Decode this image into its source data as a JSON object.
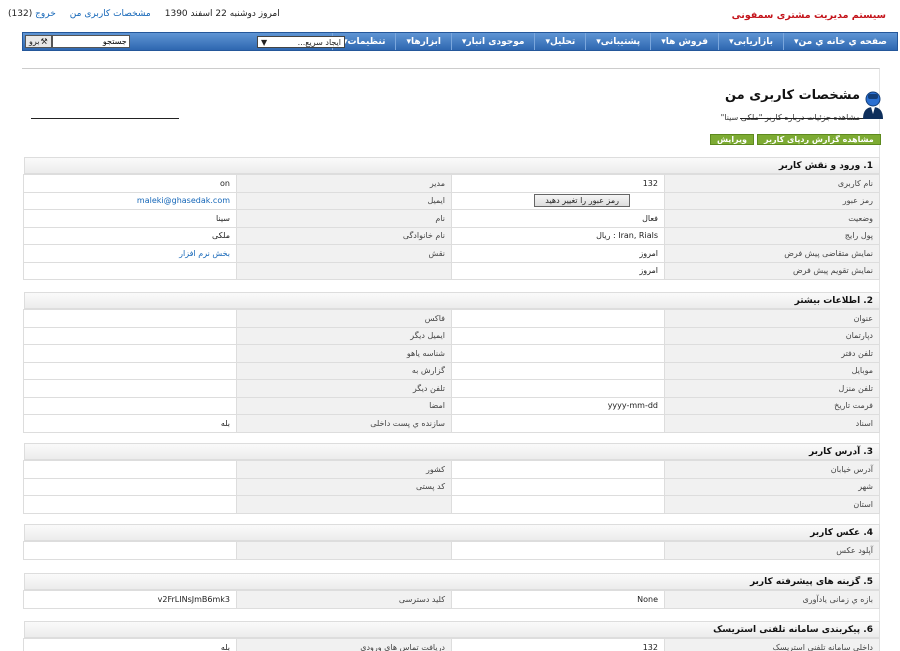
{
  "top": {
    "brand": "سیستم مدیریت مشتری سمفونی",
    "date": "امروز دوشنبه 22 اسفند 1390",
    "profile_link": "مشخصات کاربری من",
    "logout": "خروج",
    "logout_count": "(132)"
  },
  "nav": {
    "menu": [
      "صفحه ي خانه ي من▾",
      "بازاریابی▾",
      "فروش ها▾",
      "پشتیبانی▾",
      "تحلیل▾",
      "موجودی انبار▾",
      "ابزارها▾",
      "تنظیمات▾"
    ],
    "quick_create": "ایجاد سریع...",
    "search_placeholder": "جستجو",
    "go": "برو"
  },
  "page": {
    "title": "مشخصات کاربری من",
    "subtitle": "مشاهده جزئیات درباره کاربر \"ملکی سینا\"",
    "btn_audit": "مشاهده گزارش ردپای کاربر",
    "btn_edit": "ویرایش"
  },
  "colors": {
    "nav": "#2e67b0",
    "action_button": "#7dab33",
    "brand": "#c4141b",
    "link": "#1466b8"
  },
  "sections": [
    {
      "title": "1. ورود و نقش کاربر",
      "rows": [
        [
          "نام کاربری",
          "132",
          "مدیر",
          "on"
        ],
        [
          "رمز عبور",
          "",
          "ایمیل",
          "maleki@ghasedak.com"
        ],
        [
          "وضعیت",
          "فعال",
          "نام",
          "سینا"
        ],
        [
          "پول رایج",
          "Iran, Rials : ریال",
          "نام خانوادگی",
          "ملکی"
        ],
        [
          "نمایش متقاضی پیش فرض",
          "امروز",
          "نقش",
          "بخش نرم افزار"
        ],
        [
          "نمایش تقویم پیش فرض",
          "امروز",
          "",
          ""
        ]
      ],
      "change_password": "رمز عبور را تغییر دهید"
    },
    {
      "title": "2. اطلاعات بیشتر",
      "rows": [
        [
          "عنوان",
          "",
          "فاکس",
          ""
        ],
        [
          "دپارتمان",
          "",
          "ایمیل دیگر",
          ""
        ],
        [
          "تلفن دفتر",
          "",
          "شناسه یاهو",
          ""
        ],
        [
          "موبایل",
          "",
          "گزارش به",
          ""
        ],
        [
          "تلفن منزل",
          "",
          "تلفن دیگر",
          ""
        ],
        [
          "فرمت تاریخ",
          "yyyy-mm-dd",
          "امضا",
          ""
        ],
        [
          "اسناد",
          "",
          "سازنده ي پست داخلی",
          "بله"
        ]
      ]
    },
    {
      "title": "3. آدرس کاربر",
      "rows": [
        [
          "آدرس خیابان",
          "",
          "کشور",
          ""
        ],
        [
          "شهر",
          "",
          "کد پستی",
          ""
        ],
        [
          "استان",
          "",
          "",
          ""
        ]
      ]
    },
    {
      "title": "4. عکس کاربر",
      "rows": [
        [
          "آپلود عکس",
          "",
          "",
          ""
        ]
      ]
    },
    {
      "title": "5. گزینه های پیشرفته کاربر",
      "rows": [
        [
          "بازه ي زمانی یادآوری",
          "None",
          "کلید دسترسی",
          "v2FrLINsJmB6mk3"
        ]
      ]
    },
    {
      "title": "6. پیکربندی سامانه تلفنی استریسک",
      "rows": [
        [
          "داخلی سامانه تلفنی استریسک",
          "132",
          "دریافت تماس های ورودی",
          "بله"
        ]
      ]
    }
  ]
}
